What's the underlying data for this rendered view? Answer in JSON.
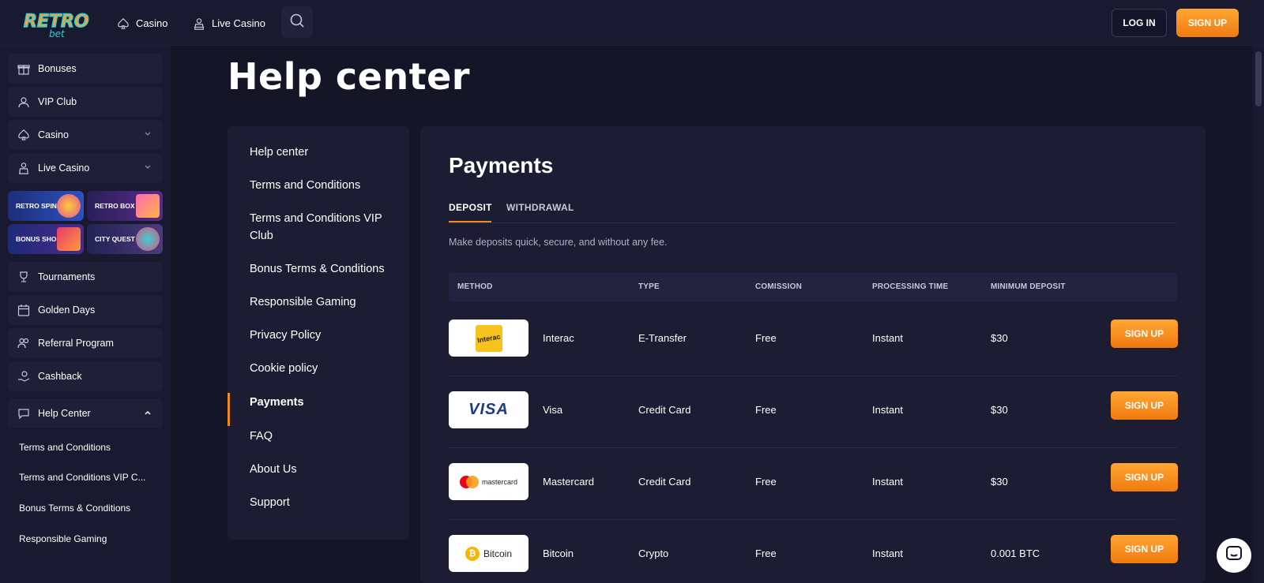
{
  "header": {
    "brand_top": "RETRO",
    "brand_bottom": "bet",
    "nav": [
      {
        "label": "Casino",
        "icon": "spade-icon"
      },
      {
        "label": "Live Casino",
        "icon": "dealer-icon"
      }
    ],
    "login_label": "LOG IN",
    "signup_label": "SIGN UP"
  },
  "sidebar": {
    "items": [
      {
        "label": "Bonuses",
        "icon": "gift-icon"
      },
      {
        "label": "VIP Club",
        "icon": "user-crown-icon"
      },
      {
        "label": "Casino",
        "icon": "spade-icon"
      },
      {
        "label": "Live Casino",
        "icon": "dealer-icon"
      },
      {
        "label": "Tournaments",
        "icon": "trophy-icon"
      },
      {
        "label": "Golden Days",
        "icon": "calendar-icon"
      },
      {
        "label": "Referral Program",
        "icon": "people-icon"
      },
      {
        "label": "Cashback",
        "icon": "hand-coin-icon"
      },
      {
        "label": "Help Center",
        "icon": "chat-icon"
      }
    ],
    "promos": [
      {
        "label": "RETRO SPIN",
        "color": "#2a4aa8"
      },
      {
        "label": "RETRO BOX",
        "color": "#3a2a7a"
      },
      {
        "label": "BONUS SHOP",
        "color": "#2a3a9a"
      },
      {
        "label": "CITY QUEST",
        "color": "#2c2c6a"
      }
    ],
    "help_sub": [
      "Terms and Conditions",
      "Terms and Conditions VIP C...",
      "Bonus Terms & Conditions",
      "Responsible Gaming"
    ]
  },
  "page_title": "Help center",
  "help_menu": [
    "Help center",
    "Terms and Conditions",
    "Terms and Conditions VIP Club",
    "Bonus Terms & Conditions",
    "Responsible Gaming",
    "Privacy Policy",
    "Cookie policy",
    "Payments",
    "FAQ",
    "About Us",
    "Support"
  ],
  "content": {
    "title": "Payments",
    "tabs": [
      "DEPOSIT",
      "WITHDRAWAL"
    ],
    "lead": "Make deposits quick, secure, and without any fee.",
    "columns": [
      "METHOD",
      "TYPE",
      "COMISSION",
      "PROCESSING TIME",
      "MINIMUM DEPOSIT"
    ],
    "rows": [
      {
        "method": "Interac",
        "logo_text": "Interac",
        "type": "E-Transfer",
        "commission": "Free",
        "time": "Instant",
        "min": "$30",
        "cta": "SIGN UP"
      },
      {
        "method": "Visa",
        "logo_text": "VISA",
        "type": "Credit Card",
        "commission": "Free",
        "time": "Instant",
        "min": "$30",
        "cta": "SIGN UP"
      },
      {
        "method": "Mastercard",
        "logo_text": "mastercard",
        "type": "Credit Card",
        "commission": "Free",
        "time": "Instant",
        "min": "$30",
        "cta": "SIGN UP"
      },
      {
        "method": "Bitcoin",
        "logo_text": "Bitcoin",
        "type": "Crypto",
        "commission": "Free",
        "time": "Instant",
        "min": "0.001 BTC",
        "cta": "SIGN UP"
      }
    ]
  },
  "colors": {
    "background": "#151528",
    "panel": "#1c1c33",
    "accent": "#f28a1e"
  }
}
